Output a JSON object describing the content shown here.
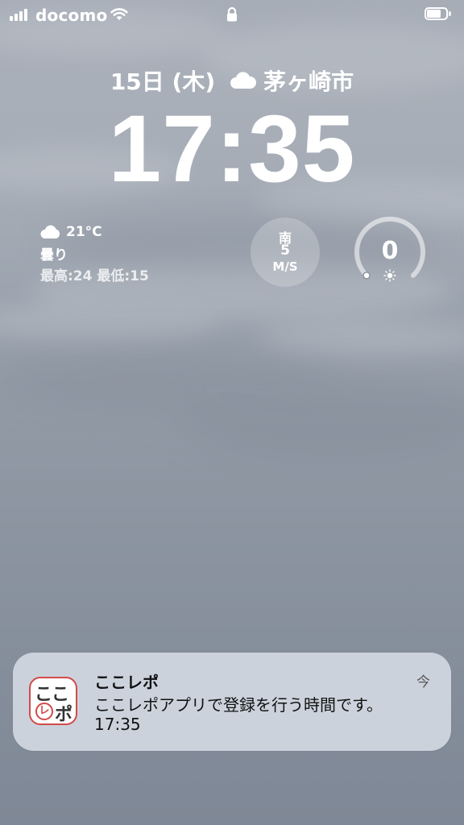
{
  "status_bar": {
    "carrier": "docomo",
    "signal_bars": 4,
    "battery_level": 0.75,
    "icons": [
      "signal-icon",
      "wifi-icon",
      "lock-icon",
      "battery-icon"
    ]
  },
  "lock_screen": {
    "date": "15日 (木)",
    "location": "茅ヶ崎市",
    "time": "17:35",
    "weather_icon": "cloud-icon"
  },
  "widgets": {
    "weather": {
      "icon": "cloud-icon",
      "temperature": "21°C",
      "condition": "曇り",
      "hi_lo": "最高:24 最低:15"
    },
    "wind": {
      "direction": "南",
      "speed": "5",
      "unit": "M/S"
    },
    "uv": {
      "value": "0",
      "icon": "sun-icon",
      "level": 0
    }
  },
  "notification": {
    "app_name": "ここレポ",
    "message": "ここレポアプリで登録を行う時間です。",
    "time": "17:35",
    "received": "今",
    "icon": {
      "line1": "ここ",
      "circle": "レ",
      "line2": "ポ"
    }
  }
}
